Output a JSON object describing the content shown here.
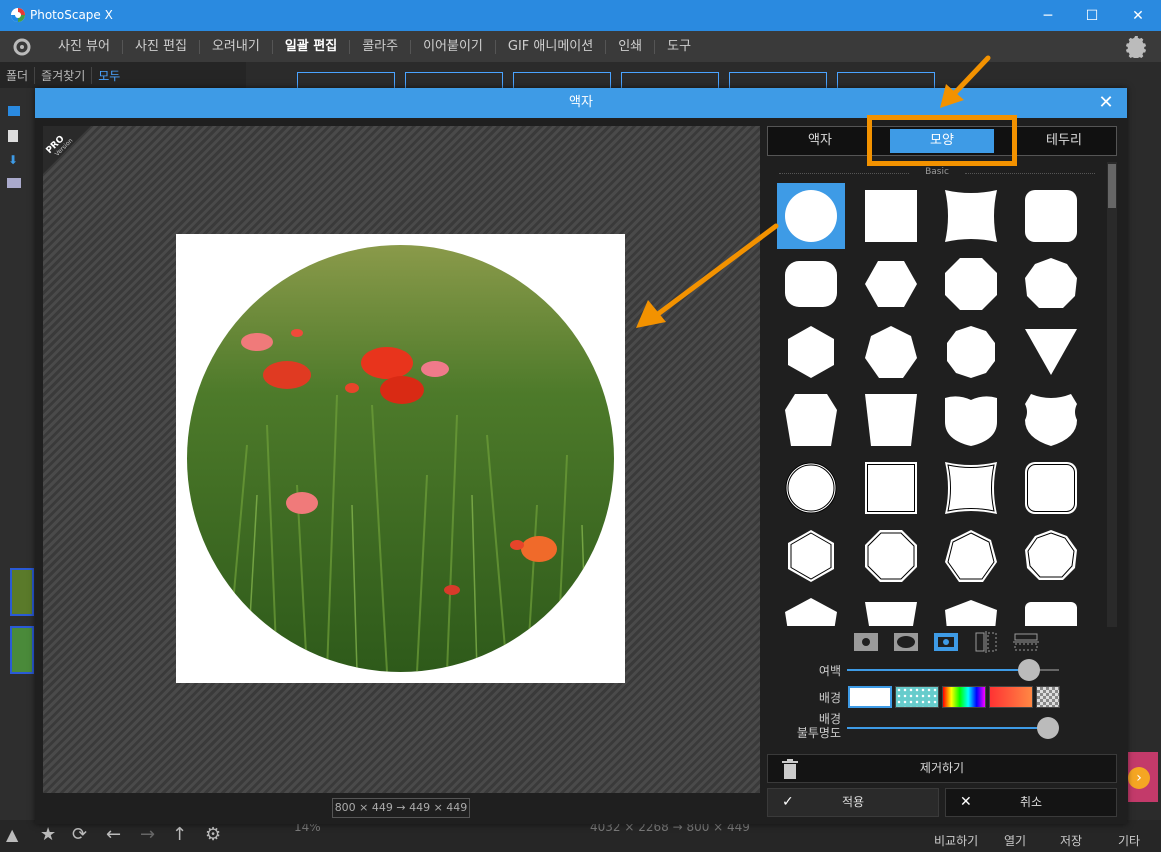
{
  "app": {
    "title": "PhotoScape X",
    "menu": [
      "사진 뷰어",
      "사진 편집",
      "오려내기",
      "일괄 편집",
      "콜라주",
      "이어붙이기",
      "GIF 애니메이션",
      "인쇄",
      "도구"
    ],
    "active_menu": "일괄 편집"
  },
  "subbar": {
    "folders": "폴더",
    "favorites": "즐겨찾기",
    "all": "모두"
  },
  "dialog": {
    "title": "액자",
    "pro_badge": "PRO",
    "pro_sub": "Version",
    "dims": "800 × 449 → 449 × 449",
    "tabs": [
      "액자",
      "모양",
      "테두리"
    ],
    "active_tab": "모양",
    "section": "Basic",
    "margin_label": "여백",
    "bg_label": "배경",
    "opacity_label_1": "배경",
    "opacity_label_2": "불투명도",
    "margin_value": 0.85,
    "opacity_value": 1.0,
    "remove_button": "제거하기",
    "apply_button": "적용",
    "cancel_button": "취소"
  },
  "bottom": {
    "compare": "비교하기",
    "open": "열기",
    "save": "저장",
    "more": "기타",
    "zoom": "14%",
    "size_info": "4032 × 2268 → 800 × 449"
  },
  "colors": {
    "accent": "#3e9be6",
    "highlight": "#f39200",
    "titlebar": "#2a8ae0"
  }
}
